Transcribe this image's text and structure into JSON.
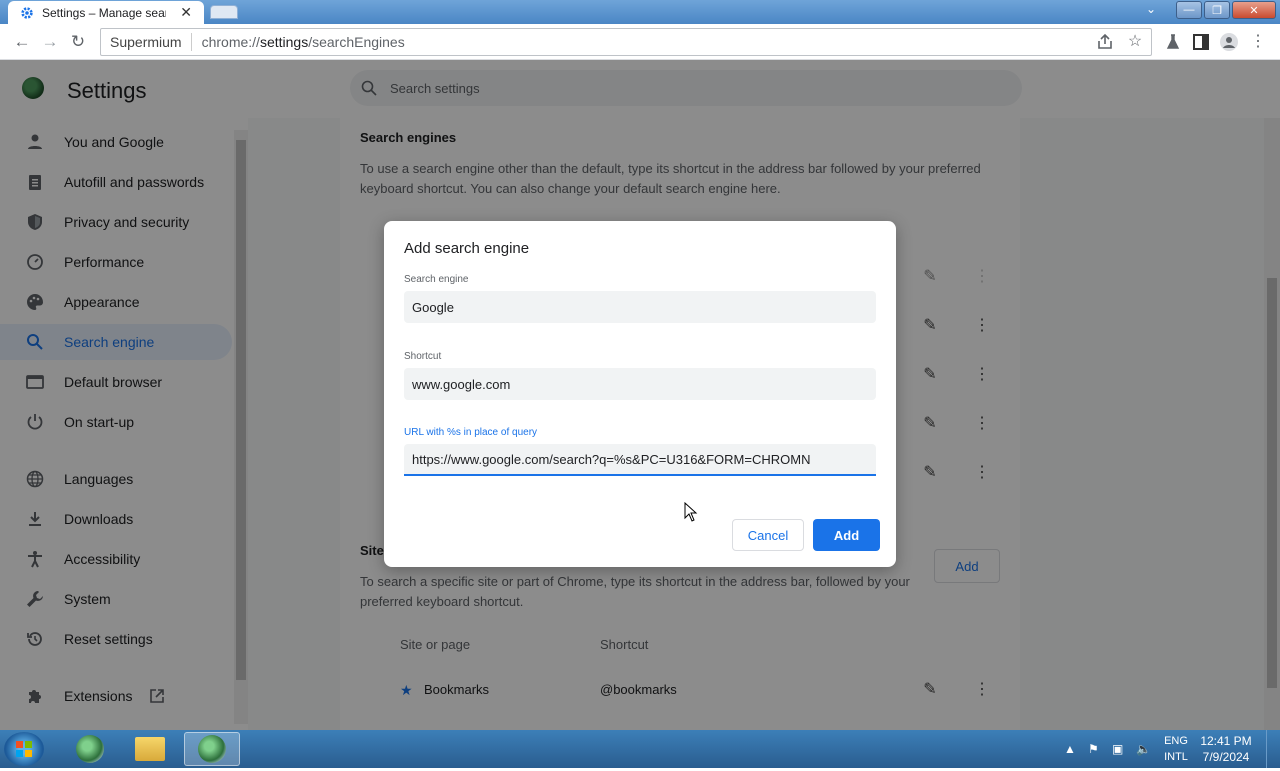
{
  "browser": {
    "tab_title": "Settings – Manage sear",
    "omnibox_host": "Supermium",
    "omnibox_scheme": "chrome://",
    "omnibox_path": "settings",
    "omnibox_rest": "/searchEngines"
  },
  "settings": {
    "title": "Settings",
    "search_placeholder": "Search settings",
    "nav": [
      {
        "label": "You and Google",
        "icon": "person-icon"
      },
      {
        "label": "Autofill and passwords",
        "icon": "clipboard-icon"
      },
      {
        "label": "Privacy and security",
        "icon": "shield-icon"
      },
      {
        "label": "Performance",
        "icon": "speedometer-icon"
      },
      {
        "label": "Appearance",
        "icon": "palette-icon"
      },
      {
        "label": "Search engine",
        "icon": "search-icon",
        "active": true
      },
      {
        "label": "Default browser",
        "icon": "browser-icon"
      },
      {
        "label": "On start-up",
        "icon": "power-icon"
      },
      {
        "label": "Languages",
        "icon": "globe-icon"
      },
      {
        "label": "Downloads",
        "icon": "download-icon"
      },
      {
        "label": "Accessibility",
        "icon": "accessibility-icon"
      },
      {
        "label": "System",
        "icon": "wrench-icon"
      },
      {
        "label": "Reset settings",
        "icon": "history-icon"
      },
      {
        "label": "Extensions",
        "icon": "puzzle-icon"
      }
    ],
    "section_title": "Search engines",
    "section_desc_1": "To use a search engine other than the default, type its shortcut in the address bar followed by your preferred",
    "section_desc_2": "keyboard shortcut. You can also change your default search engine here.",
    "site_section_title": "Site",
    "site_desc_1": "To search a specific site or part of Chrome, type its shortcut in the address bar, followed by your",
    "site_desc_2": "preferred keyboard shortcut.",
    "site_add_label": "Add",
    "col_site": "Site or page",
    "col_shortcut": "Shortcut",
    "bookmarks_label": "Bookmarks",
    "bookmarks_shortcut": "@bookmarks"
  },
  "dialog": {
    "title": "Add search engine",
    "engine_label": "Search engine",
    "engine_value": "Google",
    "shortcut_label": "Shortcut",
    "shortcut_value": "www.google.com",
    "url_label": "URL with %s in place of query",
    "url_value": "https://www.google.com/search?q=%s&PC=U316&FORM=CHROMN",
    "cancel_label": "Cancel",
    "add_label": "Add"
  },
  "taskbar": {
    "lang_1": "ENG",
    "lang_2": "INTL",
    "time": "12:41 PM",
    "date": "7/9/2024"
  },
  "colors": {
    "accent": "#1a73e8",
    "active_nav_bg": "#e8f0fe"
  }
}
